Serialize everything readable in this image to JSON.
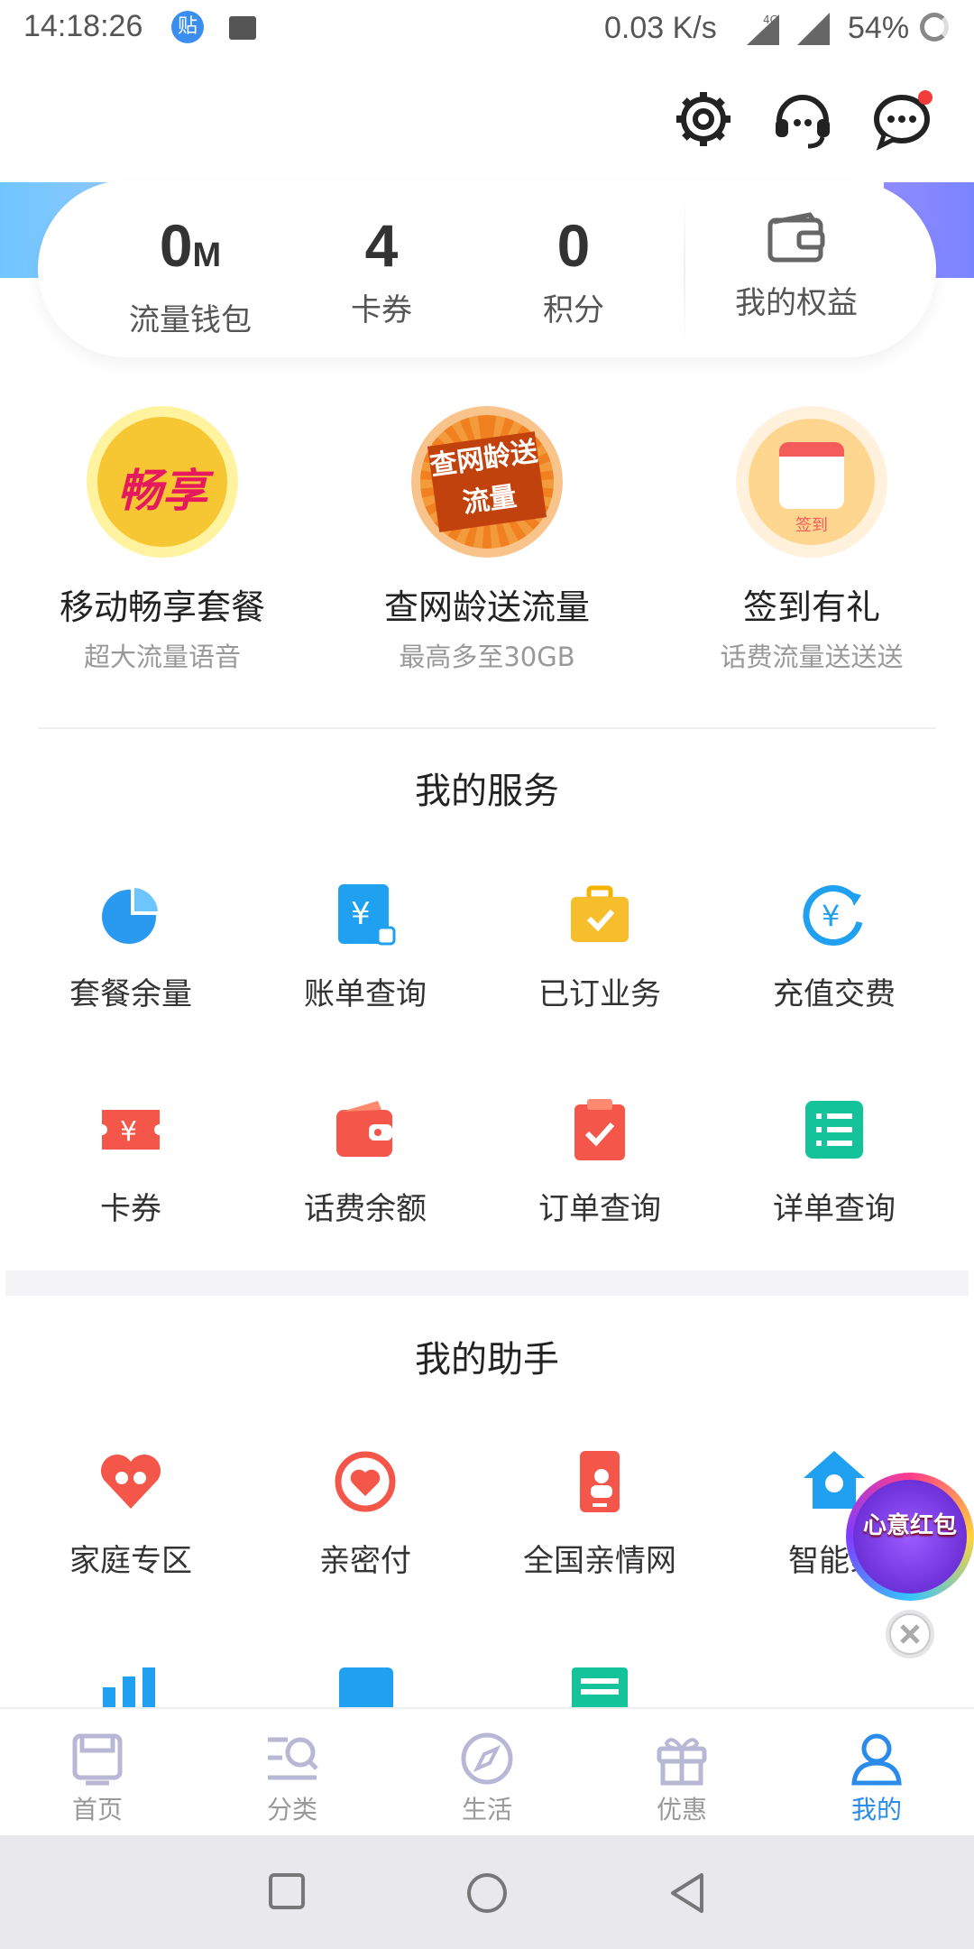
{
  "status_bar": {
    "time": "14:18:26",
    "tie_badge": "贴",
    "net_speed": "0.03 K/s",
    "network": "4G",
    "battery": "54%"
  },
  "header_icons": [
    "gear-icon",
    "headset-icon",
    "message-icon"
  ],
  "stats": {
    "flow_value": "0",
    "flow_unit": "M",
    "flow_label": "流量钱包",
    "coupons_value": "4",
    "coupons_label": "卡券",
    "points_value": "0",
    "points_label": "积分",
    "benefits_label": "我的权益"
  },
  "promos": [
    {
      "icon_text": "畅享",
      "title": "移动畅享套餐",
      "subtitle": "超大流量语音"
    },
    {
      "icon_text": "查网龄送流量",
      "title": "查网龄送流量",
      "subtitle": "最高多至30GB"
    },
    {
      "icon_text": "签到",
      "title": "签到有礼",
      "subtitle": "话费流量送送送"
    }
  ],
  "services": {
    "title": "我的服务",
    "items": [
      {
        "label": "套餐余量",
        "icon": "pie-chart-icon"
      },
      {
        "label": "账单查询",
        "icon": "bill-icon"
      },
      {
        "label": "已订业务",
        "icon": "briefcase-icon"
      },
      {
        "label": "充值交费",
        "icon": "yuan-refresh-icon"
      },
      {
        "label": "卡券",
        "icon": "coupon-icon"
      },
      {
        "label": "话费余额",
        "icon": "wallet-icon"
      },
      {
        "label": "订单查询",
        "icon": "clipboard-icon"
      },
      {
        "label": "详单查询",
        "icon": "list-icon"
      }
    ]
  },
  "assistant": {
    "title": "我的助手",
    "items": [
      {
        "label": "家庭专区",
        "icon": "heart-family-icon"
      },
      {
        "label": "亲密付",
        "icon": "heart-circle-icon"
      },
      {
        "label": "全国亲情网",
        "icon": "phone-family-icon"
      },
      {
        "label": "智能家",
        "icon": "smart-home-icon"
      }
    ]
  },
  "floating_badge": {
    "text": "心意红包"
  },
  "bottom_nav": [
    {
      "label": "首页",
      "active": false
    },
    {
      "label": "分类",
      "active": false
    },
    {
      "label": "生活",
      "active": false
    },
    {
      "label": "优惠",
      "active": false
    },
    {
      "label": "我的",
      "active": true
    }
  ],
  "colors": {
    "accent": "#2a8be8",
    "nav_inactive": "#999999",
    "promo1": "#f7c633",
    "promo2": "#f39a3a",
    "promo3": "#ffd6a0"
  }
}
